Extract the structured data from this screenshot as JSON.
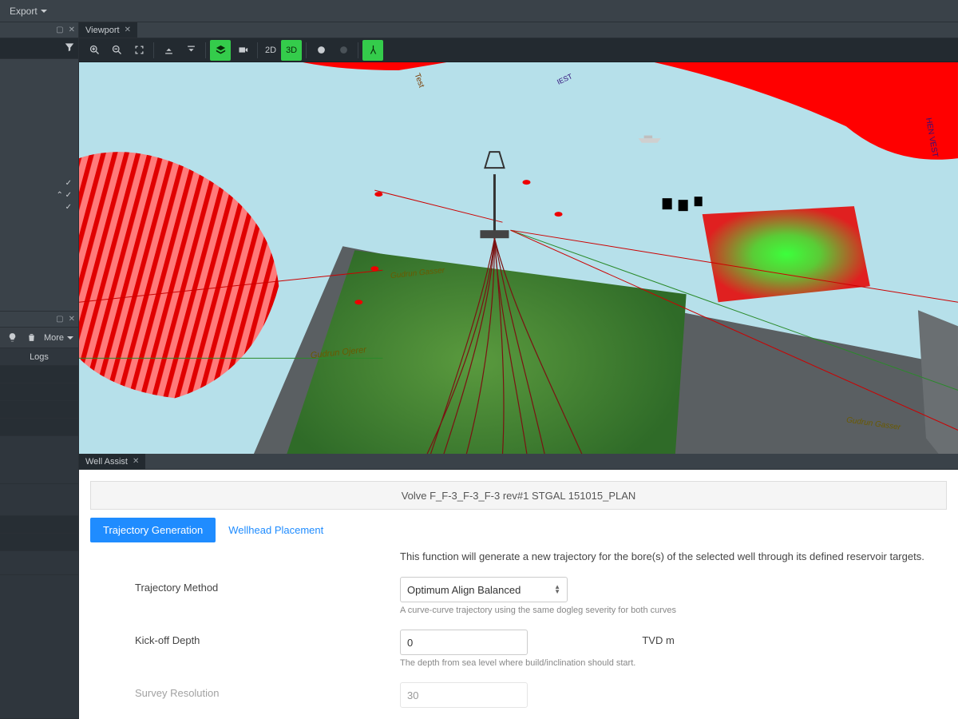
{
  "menu": {
    "export_label": "Export"
  },
  "viewport_tab": {
    "label": "Viewport"
  },
  "toolbar": {
    "mode_2d": "2D",
    "mode_3d": "3D"
  },
  "sidebar": {
    "more_label": "More",
    "logs_label": "Logs"
  },
  "well_assist_tab": {
    "label": "Well Assist"
  },
  "well_assist": {
    "title": "Volve F_F-3_F-3_F-3 rev#1 STGAL 151015_PLAN",
    "tabs": {
      "trajectory": "Trajectory Generation",
      "wellhead": "Wellhead Placement"
    },
    "description": "This function will generate a new trajectory for the bore(s) of the selected well through its defined reservoir targets.",
    "fields": {
      "method": {
        "label": "Trajectory Method",
        "value": "Optimum Align Balanced",
        "hint": "A curve-curve trajectory using the same dogleg severity for both curves"
      },
      "kickoff": {
        "label": "Kick-off Depth",
        "value": "0",
        "unit": "TVD m",
        "hint": "The depth from sea level where build/inclination should start."
      },
      "survey": {
        "label": "Survey Resolution",
        "value": "30"
      }
    }
  },
  "scene_labels": {
    "gudrun_ojerer": "Gudrun Ojerer",
    "gudrun_gasser": "Gudrun Gasser",
    "iest": "IEST",
    "hen_vest": "HEN VEST"
  }
}
